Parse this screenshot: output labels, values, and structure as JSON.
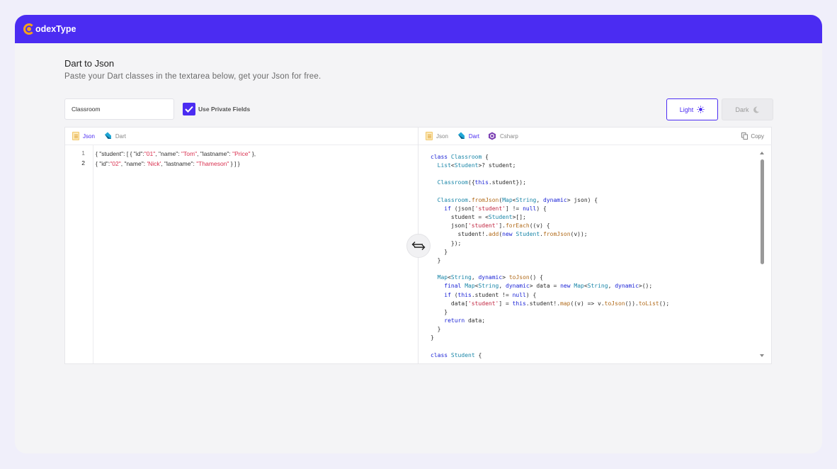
{
  "brand": {
    "name": "odexType"
  },
  "page": {
    "title": "Dart to Json",
    "subtitle": "Paste your Dart classes in the textarea below, get your Json for free."
  },
  "controls": {
    "class_name_value": "Classroom",
    "private_fields_label": "Use Private Fields",
    "private_fields_checked": true,
    "theme_light_label": "Light",
    "theme_dark_label": "Dark"
  },
  "left_pane": {
    "tabs": [
      {
        "label": "Json",
        "icon": "json-file-icon",
        "active": true
      },
      {
        "label": "Dart",
        "icon": "dart-icon",
        "active": false
      }
    ],
    "line_numbers": [
      "1",
      "2"
    ]
  },
  "right_pane": {
    "tabs": [
      {
        "label": "Json",
        "icon": "json-file-icon",
        "active": false
      },
      {
        "label": "Dart",
        "icon": "dart-icon",
        "active": true
      },
      {
        "label": "Csharp",
        "icon": "csharp-icon",
        "active": false
      }
    ],
    "copy_label": "Copy"
  },
  "colors": {
    "accent": "#4b2cf2",
    "logo": "#f6a21a",
    "string": "#d9304f",
    "keyword": "#1c24d6",
    "type": "#1a86a8",
    "function": "#b16a19"
  }
}
